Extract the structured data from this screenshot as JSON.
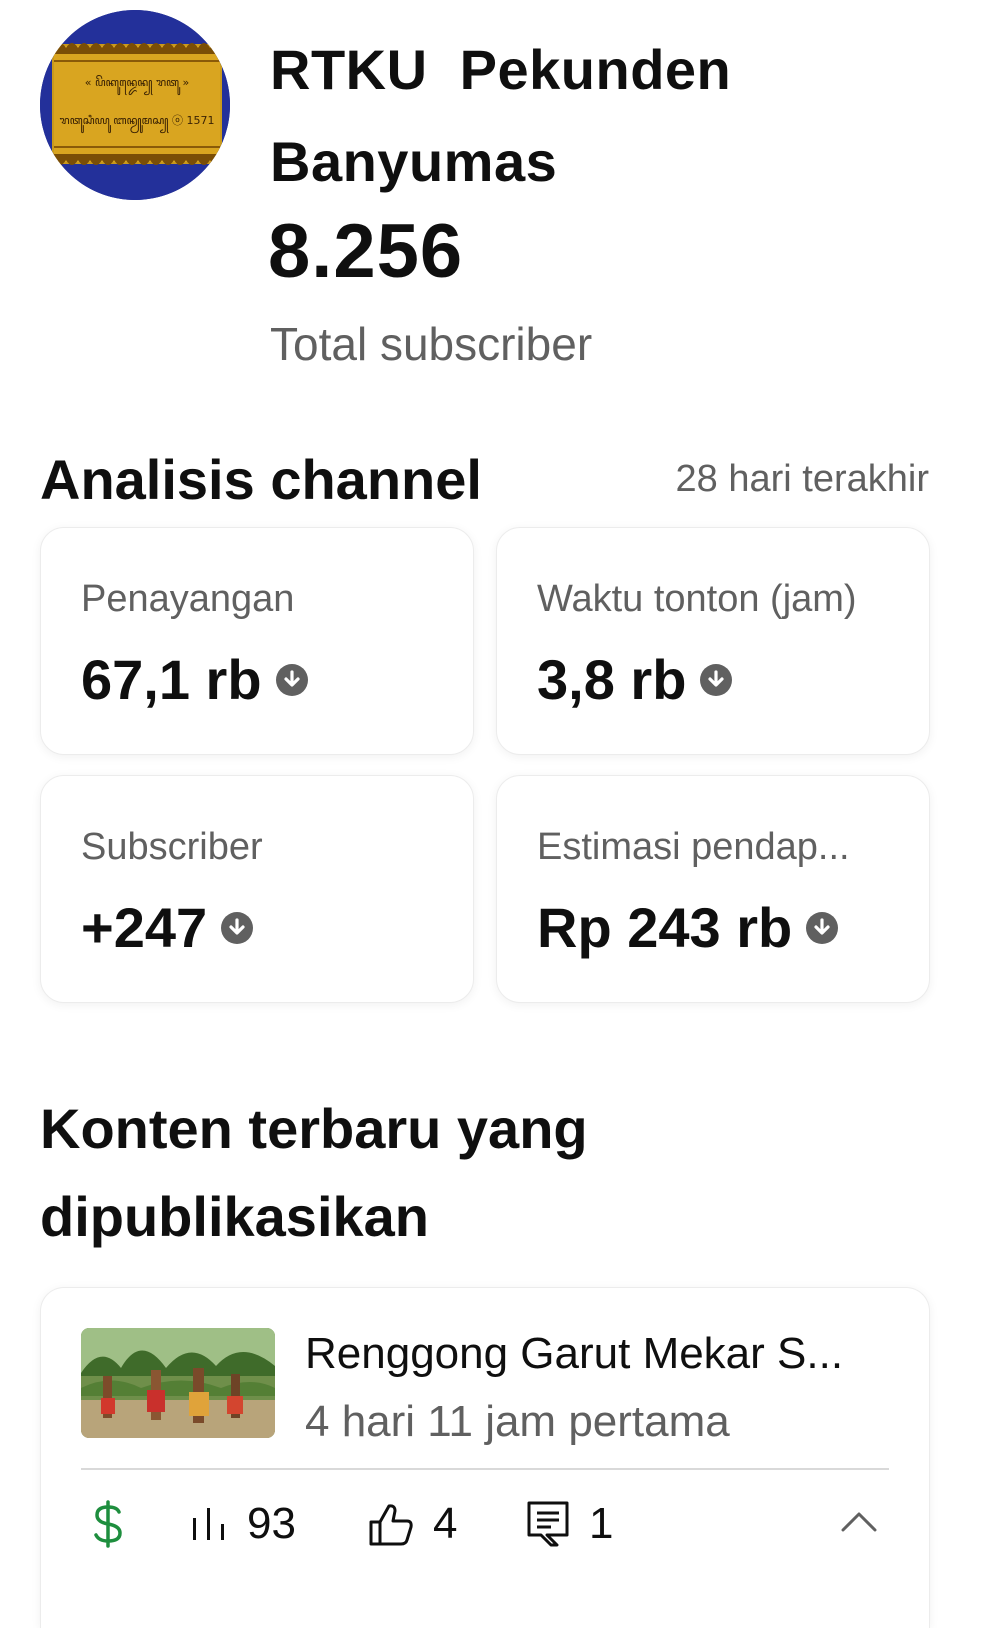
{
  "channel": {
    "name": "RTKU  Pekunden Banyumas",
    "subscriber_count": "8.256",
    "subscriber_label": "Total subscriber",
    "avatar_icon": "channel-avatar-logo",
    "avatar_text_line1": "« ꦥꦼꦏꦸꦤ꧀ꦢꦺꦤ꧀ ꦫꦠꦸ »",
    "avatar_text_line2": "ꦫꦠꦸꦱꦶꦪꦸ ꦧꦤꦾꦸꦩꦱ꧀ ⓞ 1571"
  },
  "analytics": {
    "title": "Analisis channel",
    "range": "28 hari terakhir",
    "cards": [
      {
        "label": "Penayangan",
        "value": "67,1 rb",
        "trend": "down",
        "trend_icon": "arrow-down-circle-icon"
      },
      {
        "label": "Waktu tonton (jam)",
        "value": "3,8 rb",
        "trend": "down",
        "trend_icon": "arrow-down-circle-icon"
      },
      {
        "label": "Subscriber",
        "value": "+247",
        "trend": "down",
        "trend_icon": "arrow-down-circle-icon"
      },
      {
        "label": "Estimasi pendap...",
        "value": "Rp 243 rb",
        "trend": "down",
        "trend_icon": "arrow-down-circle-icon"
      }
    ]
  },
  "recent_content": {
    "title": "Konten terbaru yang dipublikasikan",
    "video": {
      "title": "Renggong Garut Mekar S...",
      "meta": "4 hari 11 jam pertama",
      "thumbnail_icon": "video-thumbnail",
      "metrics": {
        "revenue_icon": "dollar-icon",
        "views_icon": "bar-chart-icon",
        "views": "93",
        "likes_icon": "thumbs-up-icon",
        "likes": "4",
        "comments_icon": "comment-icon",
        "comments": "1",
        "expand_icon": "chevron-up-icon"
      }
    }
  },
  "colors": {
    "text_primary": "#0f0f0f",
    "text_secondary": "#606060",
    "revenue_green": "#1e8e3e",
    "card_border": "#ececec",
    "avatar_blue": "#1f2a86",
    "avatar_gold": "#d9a520"
  }
}
